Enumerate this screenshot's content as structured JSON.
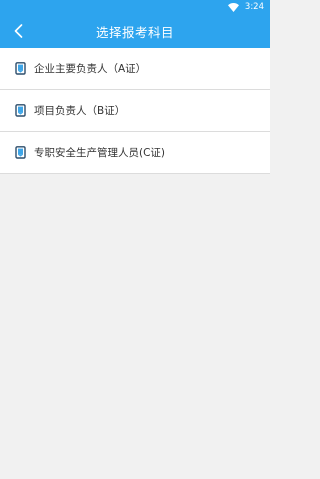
{
  "status_bar": {
    "time": "3:24",
    "wifi_icon": "wifi-icon"
  },
  "app_bar": {
    "title": "选择报考科目",
    "back_icon": "back-arrow-icon",
    "color": "#2da4ee"
  },
  "items": [
    {
      "label": "企业主要负责人（A证）",
      "icon": "book-icon"
    },
    {
      "label": "项目负责人（B证）",
      "icon": "book-icon"
    },
    {
      "label": "专职安全生产管理人员(C证)",
      "icon": "book-icon"
    }
  ]
}
